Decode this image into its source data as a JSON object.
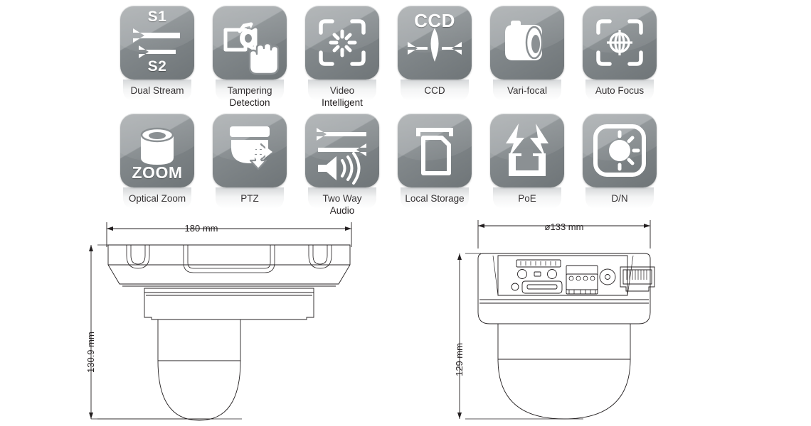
{
  "features": {
    "rows": [
      [
        {
          "label": "Dual Stream",
          "icon": "dual-stream-icon",
          "glyph_top": "S1",
          "glyph_bottom": "S2"
        },
        {
          "label": "Tampering\nDetection",
          "icon": "tampering-detection-icon"
        },
        {
          "label": "Video\nIntelligent",
          "icon": "video-intelligent-icon"
        },
        {
          "label": "CCD",
          "icon": "ccd-icon",
          "glyph_top": "CCD"
        },
        {
          "label": "Vari-focal",
          "icon": "vari-focal-lens-icon"
        },
        {
          "label": "Auto Focus",
          "icon": "auto-focus-icon"
        }
      ],
      [
        {
          "label": "Optical Zoom",
          "icon": "optical-zoom-icon",
          "glyph_bottom": "ZOOM"
        },
        {
          "label": "PTZ",
          "icon": "ptz-icon"
        },
        {
          "label": "Two Way\nAudio",
          "icon": "two-way-audio-icon"
        },
        {
          "label": "Local Storage",
          "icon": "local-storage-sd-card-icon"
        },
        {
          "label": "PoE",
          "icon": "poe-icon"
        },
        {
          "label": "D/N",
          "icon": "day-night-icon"
        }
      ]
    ]
  },
  "colors": {
    "tile_light": "#a7abad",
    "tile_dark": "#6f7578",
    "glyph": "#ffffff",
    "text": "#231f20",
    "line": "#231f20"
  },
  "drawings": [
    {
      "name": "front-view",
      "width_dimension": "180 mm",
      "height_dimension": "130.9 mm"
    },
    {
      "name": "side-view",
      "width_dimension": "ø133 mm",
      "height_dimension": "129 mm"
    }
  ]
}
